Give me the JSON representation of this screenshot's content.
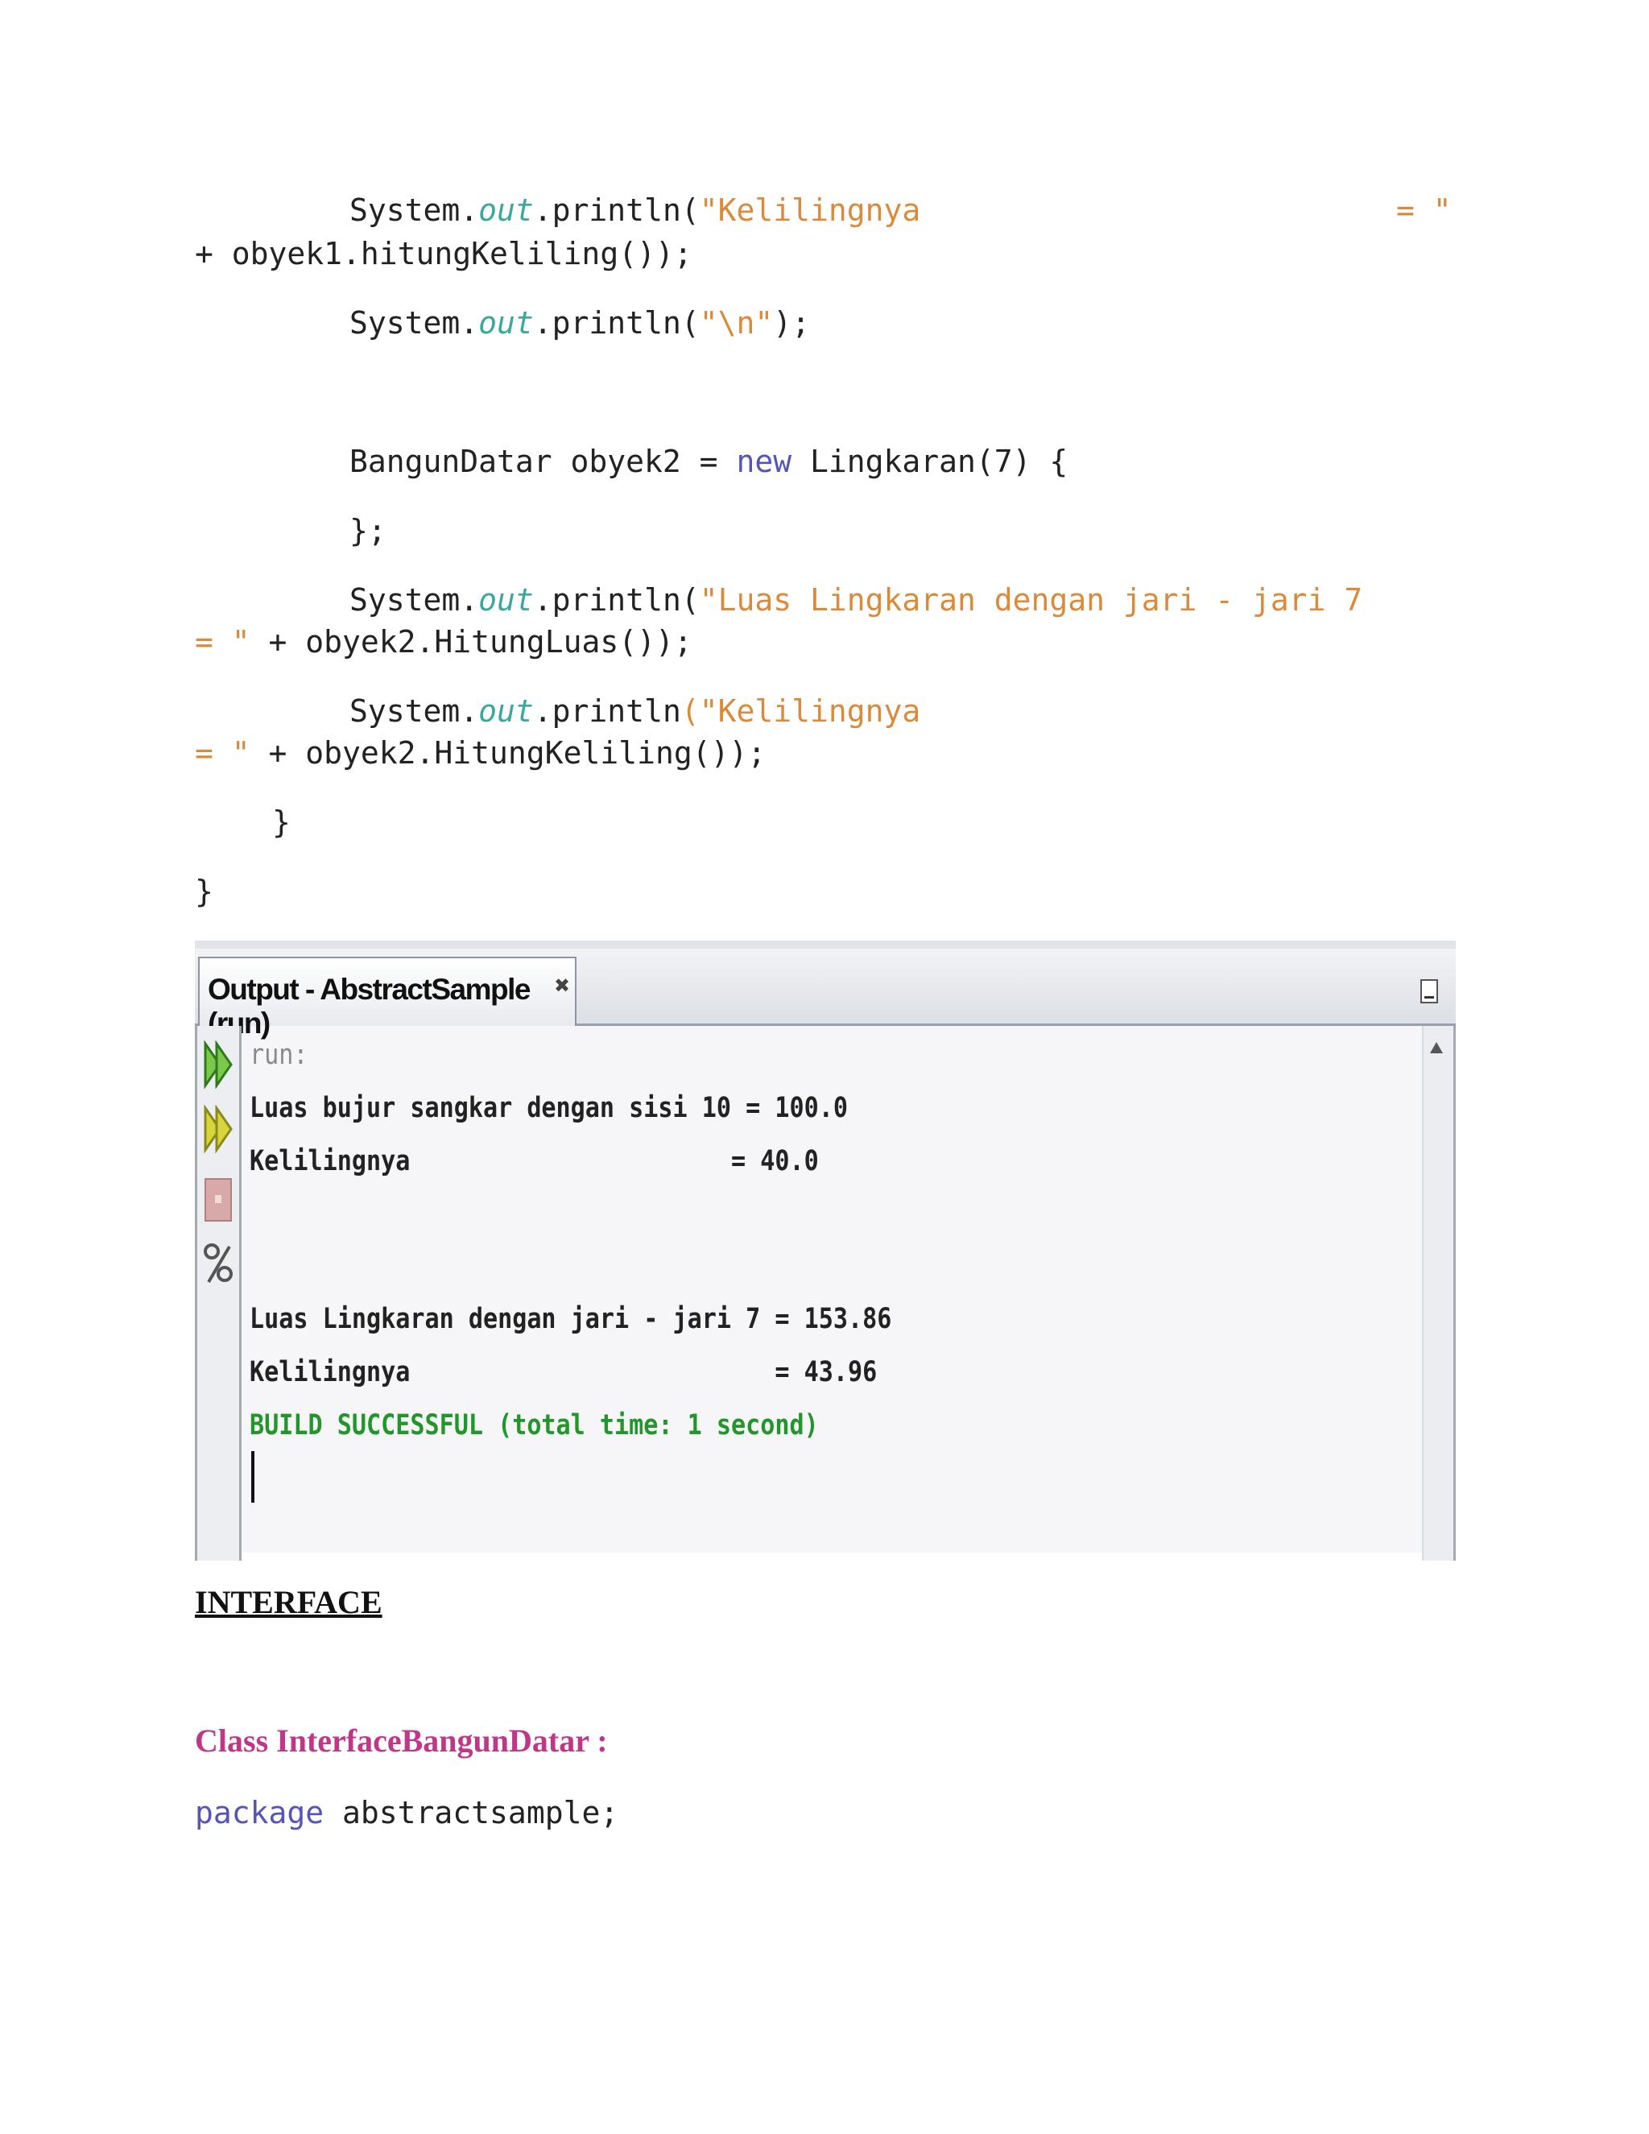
{
  "code": {
    "l1_system": "System.",
    "l1_out": "out",
    "l1_println": ".println(",
    "l1_str": "\"Kelilingnya",
    "l1_str_end": "= \"",
    "l2": "+ obyek1.hitungKeliling());",
    "l3_system": "System.",
    "l3_out": "out",
    "l3_println": ".println(",
    "l3_str": "\"\\n\"",
    "l3_end": ");",
    "l4_a": "BangunDatar obyek2 = ",
    "l4_new": "new",
    "l4_b": " Lingkaran(7) {",
    "l5": "};",
    "l6_system": "System.",
    "l6_out": "out",
    "l6_println": ".println(",
    "l6_str": "\"Luas Lingkaran dengan jari - jari 7",
    "l7_str": "= \"",
    "l7_rest": " + obyek2.HitungLuas());",
    "l8_system": "System.",
    "l8_out": "out",
    "l8_println": ".println",
    "l8_str": "(\"Kelilingnya",
    "l9_str": "= \"",
    "l9_rest": " + obyek2.HitungKeliling());",
    "l10": "}",
    "l11": "}"
  },
  "output_window": {
    "tab_title": "Output - AbstractSample (run)",
    "close_glyph": "✖",
    "gutter_icons": [
      "rerun-icon",
      "rerun-with-options-icon",
      "stop-icon",
      "settings-icon"
    ],
    "lines": {
      "run": "run:",
      "bujur_luas": "Luas bujur sangkar dengan sisi 10 = 100.0",
      "bujur_keliling": "Kelilingnya                      = 40.0",
      "lingkaran_luas": "Luas Lingkaran dengan jari - jari 7 = 153.86",
      "lingkaran_keliling": "Kelilingnya                         = 43.96",
      "build": "BUILD SUCCESSFUL (total time: 1 second)"
    }
  },
  "headings": {
    "interface": "INTERFACE",
    "class_title": "Class InterfaceBangunDatar :"
  },
  "code2": {
    "package_kw": "package",
    "package_rest": " abstractsample;"
  }
}
